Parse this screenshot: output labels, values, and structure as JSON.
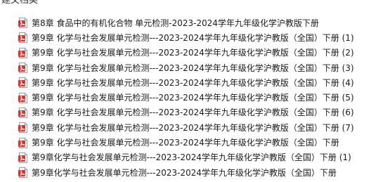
{
  "header": {
    "title": "建文档类"
  },
  "colors": {
    "icon_red": "#d9342b",
    "text": "#1a1a1a"
  },
  "files": [
    {
      "icon": "pdf-icon",
      "name": "第8章 食品中的有机化合物 单元检测-2023-2024学年九年级化学沪教版下册"
    },
    {
      "icon": "pdf-icon",
      "name": "第9章 化学与社会发展单元检测---2023-2024学年九年级化学沪教版（全国）下册 (1)"
    },
    {
      "icon": "pdf-icon",
      "name": "第9章 化学与社会发展单元检测---2023-2024学年九年级化学沪教版（全国）下册 (2)"
    },
    {
      "icon": "pdf-icon",
      "name": "第9章 化学与社会发展单元检测---2023-2024学年九年级化学沪教版（全国）下册 (3)"
    },
    {
      "icon": "pdf-icon",
      "name": "第9章 化学与社会发展单元检测---2023-2024学年九年级化学沪教版（全国）下册 (4)"
    },
    {
      "icon": "pdf-icon",
      "name": "第9章 化学与社会发展单元检测---2023-2024学年九年级化学沪教版（全国）下册 (5)"
    },
    {
      "icon": "pdf-icon",
      "name": "第9章 化学与社会发展单元检测---2023-2024学年九年级化学沪教版（全国）下册 (6)"
    },
    {
      "icon": "pdf-icon",
      "name": "第9章 化学与社会发展单元检测---2023-2024学年九年级化学沪教版（全国）下册 (7)"
    },
    {
      "icon": "pdf-icon",
      "name": "第9章 化学与社会发展单元检测---2023-2024学年九年级化学沪教版（全国）下册"
    },
    {
      "icon": "pdf-icon",
      "name": "第9章化学与社会发展单元检测---2023-2024学年九年级化学沪教版（全国）下册 (1)"
    },
    {
      "icon": "pdf-icon",
      "name": "第9章化学与社会发展单元检测---2023-2024学年九年级化学沪教版（全国）下册"
    }
  ]
}
